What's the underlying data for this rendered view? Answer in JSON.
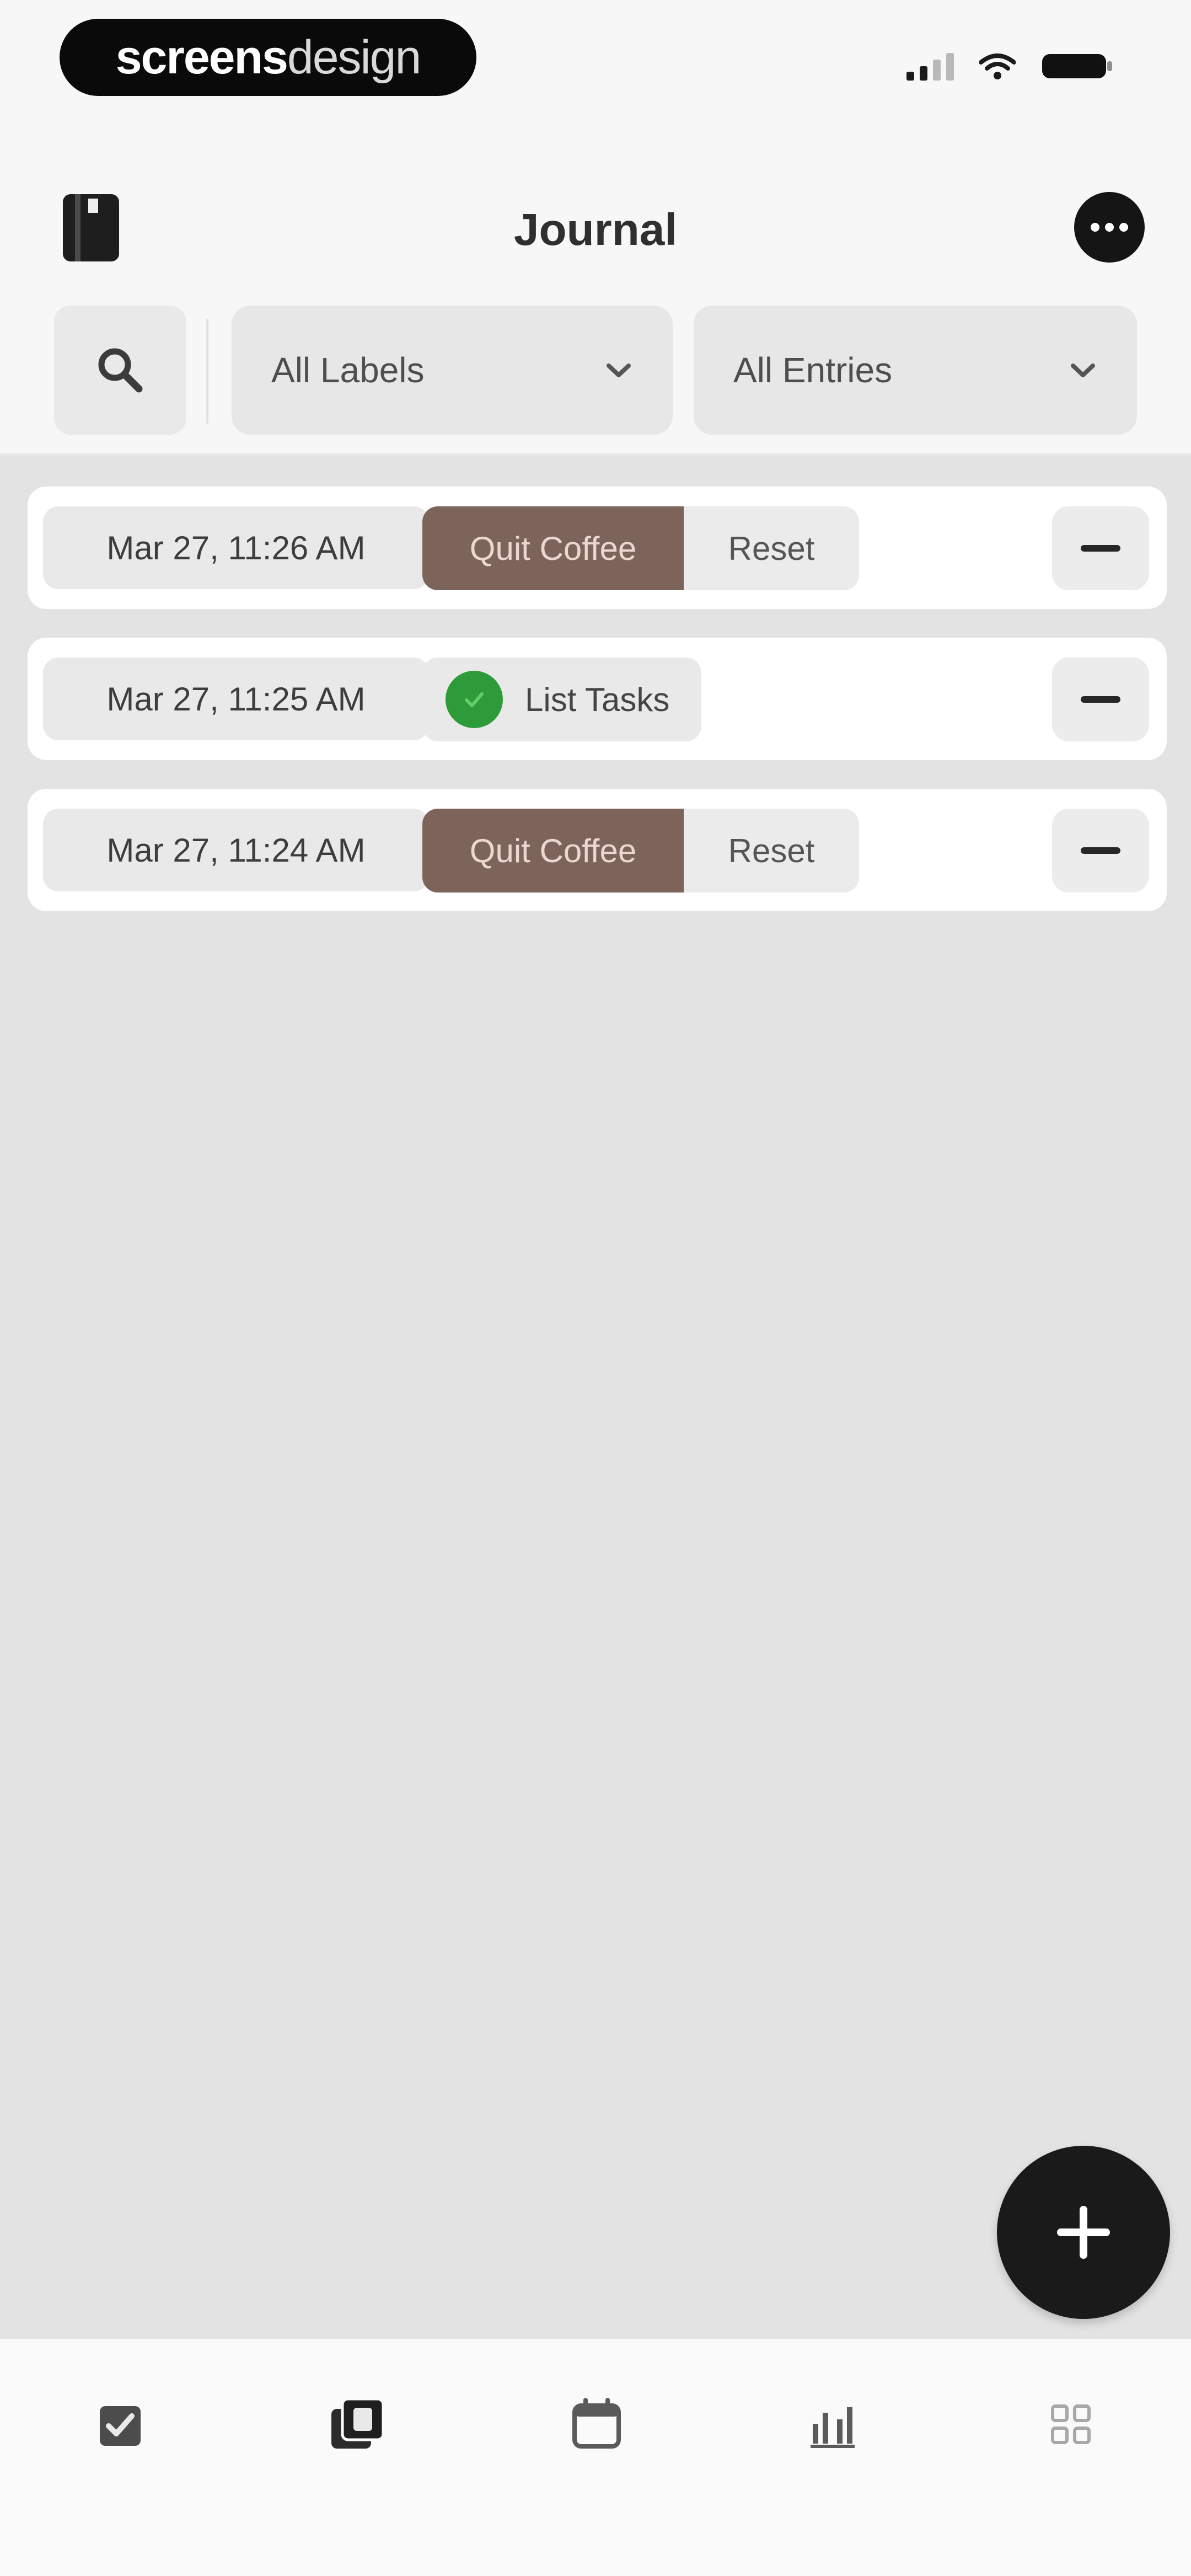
{
  "status_bar": {
    "brand_main": "screens",
    "brand_secondary": "design"
  },
  "header": {
    "title": "Journal"
  },
  "filters": {
    "labels_dropdown": "All Labels",
    "entries_dropdown": "All Entries"
  },
  "entries": [
    {
      "timestamp": "Mar 27, 11:26 AM",
      "label": "Quit Coffee",
      "action": "Reset",
      "type": "habit"
    },
    {
      "timestamp": "Mar 27, 11:25 AM",
      "label": "List Tasks",
      "type": "task",
      "status": "completed"
    },
    {
      "timestamp": "Mar 27, 11:24 AM",
      "label": "Quit Coffee",
      "action": "Reset",
      "type": "habit"
    }
  ],
  "fab": {
    "icon": "plus-icon"
  },
  "tab_bar": {
    "items": [
      {
        "icon": "checklist-icon",
        "active": false
      },
      {
        "icon": "journal-icon",
        "active": true
      },
      {
        "icon": "calendar-icon",
        "active": false
      },
      {
        "icon": "stats-icon",
        "active": false
      },
      {
        "icon": "grid-icon",
        "active": false
      }
    ]
  },
  "colors": {
    "habit_label": "#7d645b",
    "task_check": "#2e9b3a",
    "list_background": "#e3e3e3",
    "fab": "#1a1a1a"
  }
}
